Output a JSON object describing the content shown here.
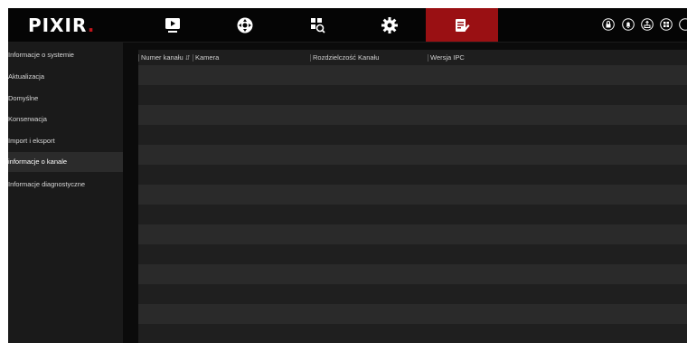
{
  "app": {
    "logo_text": "PIXIR",
    "accent": "#9a1013",
    "brand_red": "#c1151b"
  },
  "nav": {
    "items": [
      {
        "name": "playback",
        "icon": "play-icon",
        "active": false
      },
      {
        "name": "ptz",
        "icon": "ptz-control-icon",
        "active": false
      },
      {
        "name": "search",
        "icon": "video-search-icon",
        "active": false
      },
      {
        "name": "settings",
        "icon": "gear-icon",
        "active": false
      },
      {
        "name": "system",
        "icon": "system-edit-icon",
        "active": true
      }
    ],
    "utility_icons": [
      "lock-icon",
      "bell-icon",
      "export-icon",
      "grid-icon",
      "more-icon"
    ]
  },
  "sidebar": {
    "items": [
      {
        "label": "Informacje o systemie",
        "active": false
      },
      {
        "label": "Aktualizacja",
        "active": false
      },
      {
        "label": "Domyślne",
        "active": false
      },
      {
        "label": "Konserwacja",
        "active": false
      },
      {
        "label": "Import i eksport",
        "active": false
      },
      {
        "label": "informacje o kanale",
        "active": true
      },
      {
        "label": "Informacje diagnostyczne",
        "active": false
      }
    ]
  },
  "table": {
    "columns": [
      {
        "label": "Numer kanału",
        "sortable": true
      },
      {
        "label": "Kamera",
        "sortable": false
      },
      {
        "label": "Rozdzielczość Kanału",
        "sortable": false
      },
      {
        "label": "Wersja IPC",
        "sortable": false
      }
    ],
    "rows": []
  }
}
